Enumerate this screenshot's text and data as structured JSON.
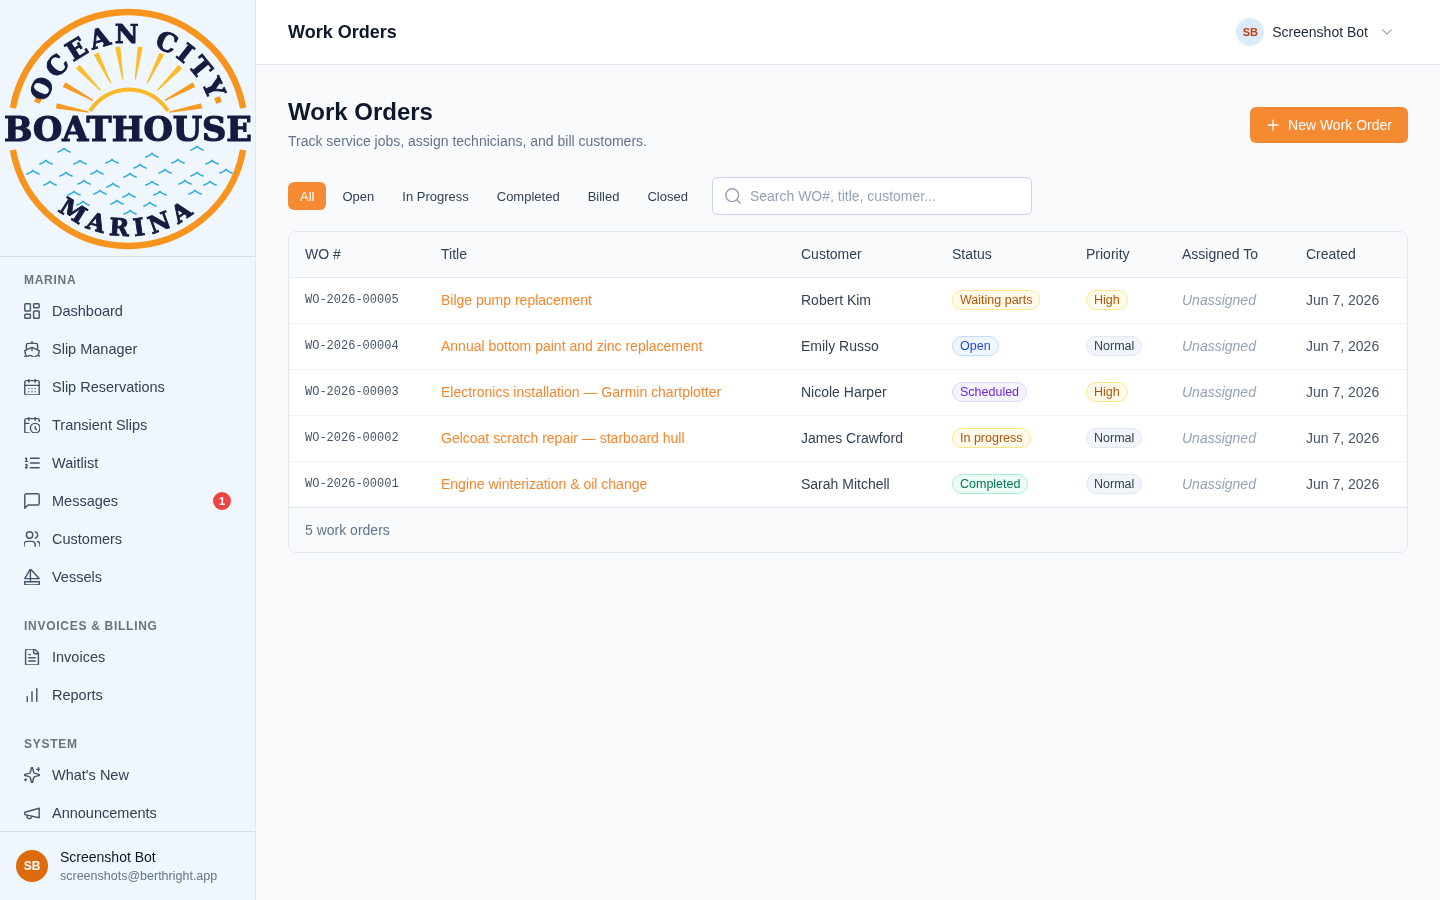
{
  "sidebar": {
    "logo": {
      "top_text": "OCEAN CITY",
      "main_text": "BOATHOUSE",
      "bottom_text": "MARINA"
    },
    "sections": [
      {
        "heading": "MARINA",
        "items": [
          {
            "label": "Dashboard"
          },
          {
            "label": "Slip Manager"
          },
          {
            "label": "Slip Reservations"
          },
          {
            "label": "Transient Slips"
          },
          {
            "label": "Waitlist"
          },
          {
            "label": "Messages",
            "badge": "1"
          },
          {
            "label": "Customers"
          },
          {
            "label": "Vessels"
          }
        ]
      },
      {
        "heading": "INVOICES & BILLING",
        "items": [
          {
            "label": "Invoices"
          },
          {
            "label": "Reports"
          }
        ]
      },
      {
        "heading": "SYSTEM",
        "items": [
          {
            "label": "What's New"
          },
          {
            "label": "Announcements"
          }
        ]
      }
    ],
    "user": {
      "initials": "SB",
      "name": "Screenshot Bot",
      "email": "screenshots@berthright.app"
    }
  },
  "header": {
    "title": "Work Orders",
    "user": {
      "initials": "SB",
      "name": "Screenshot Bot"
    }
  },
  "page": {
    "title": "Work Orders",
    "subtitle": "Track service jobs, assign technicians, and bill customers.",
    "new_button": "New Work Order",
    "filters": [
      {
        "label": "All",
        "selected": true
      },
      {
        "label": "Open",
        "selected": false
      },
      {
        "label": "In Progress",
        "selected": false
      },
      {
        "label": "Completed",
        "selected": false
      },
      {
        "label": "Billed",
        "selected": false
      },
      {
        "label": "Closed",
        "selected": false
      }
    ],
    "search": {
      "placeholder": "Search WO#, title, customer..."
    }
  },
  "table": {
    "columns": [
      "WO #",
      "Title",
      "Customer",
      "Status",
      "Priority",
      "Assigned To",
      "Created"
    ],
    "rows": [
      {
        "wo_number": "WO-2026-00005",
        "title": "Bilge pump replacement",
        "customer": "Robert Kim",
        "status": {
          "label": "Waiting parts",
          "kind": "amber"
        },
        "priority": {
          "label": "High",
          "kind": "amber"
        },
        "assigned_to": "Unassigned",
        "created": "Jun 7, 2026"
      },
      {
        "wo_number": "WO-2026-00004",
        "title": "Annual bottom paint and zinc replacement",
        "customer": "Emily Russo",
        "status": {
          "label": "Open",
          "kind": "blue"
        },
        "priority": {
          "label": "Normal",
          "kind": "slate"
        },
        "assigned_to": "Unassigned",
        "created": "Jun 7, 2026"
      },
      {
        "wo_number": "WO-2026-00003",
        "title": "Electronics installation — Garmin chartplotter",
        "customer": "Nicole Harper",
        "status": {
          "label": "Scheduled",
          "kind": "violet"
        },
        "priority": {
          "label": "High",
          "kind": "amber"
        },
        "assigned_to": "Unassigned",
        "created": "Jun 7, 2026"
      },
      {
        "wo_number": "WO-2026-00002",
        "title": "Gelcoat scratch repair — starboard hull",
        "customer": "James Crawford",
        "status": {
          "label": "In progress",
          "kind": "amber"
        },
        "priority": {
          "label": "Normal",
          "kind": "slate"
        },
        "assigned_to": "Unassigned",
        "created": "Jun 7, 2026"
      },
      {
        "wo_number": "WO-2026-00001",
        "title": "Engine winterization & oil change",
        "customer": "Sarah Mitchell",
        "status": {
          "label": "Completed",
          "kind": "green"
        },
        "priority": {
          "label": "Normal",
          "kind": "slate"
        },
        "assigned_to": "Unassigned",
        "created": "Jun 7, 2026"
      }
    ],
    "footer": "5 work orders"
  }
}
